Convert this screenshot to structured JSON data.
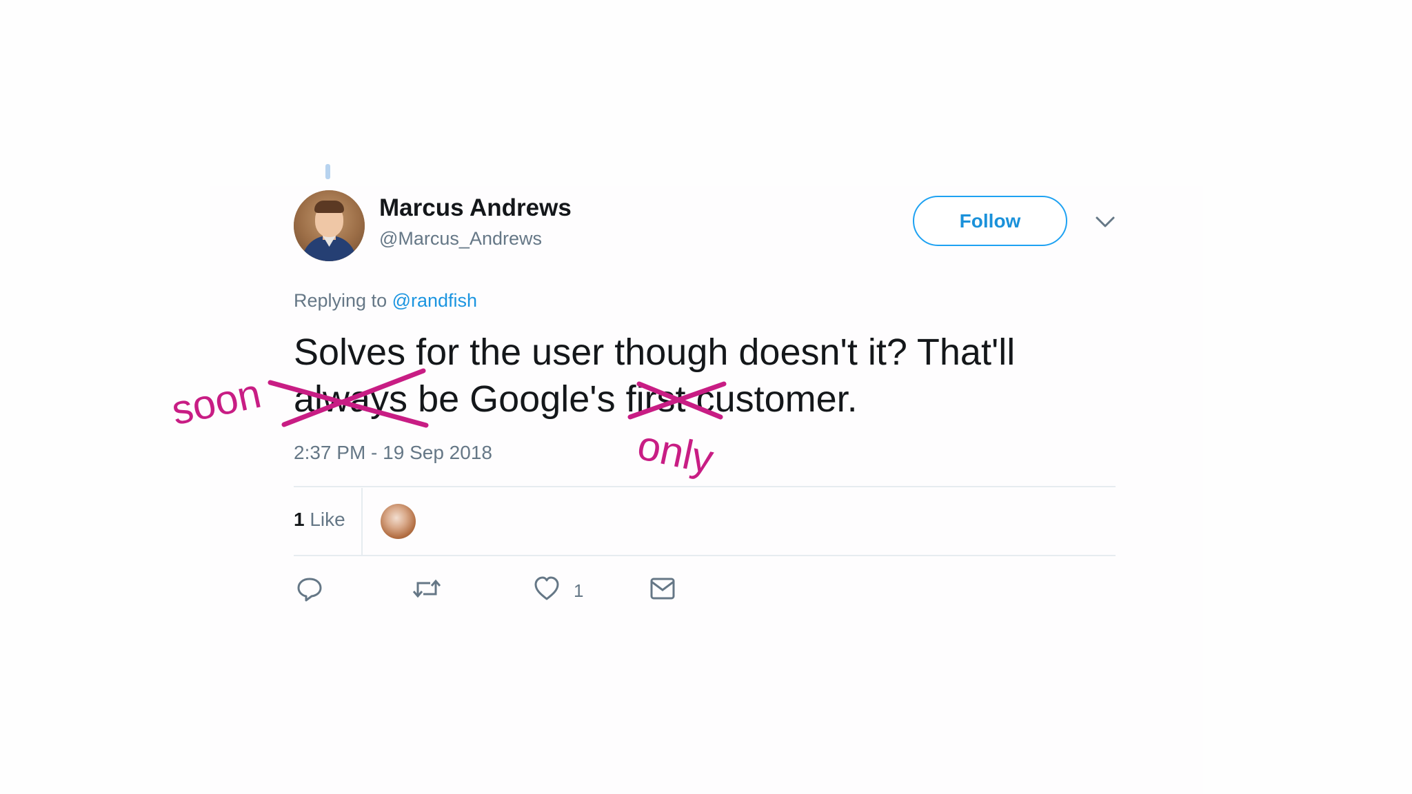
{
  "tweet": {
    "author_name": "Marcus Andrews",
    "author_handle": "@Marcus_Andrews",
    "follow_label": "Follow",
    "replying_prefix": "Replying to",
    "replying_mention": "@randfish",
    "text_line1": "Solves for the user though doesn't it? That'll",
    "text_line2_a": "always",
    "text_line2_b": " be Google's ",
    "text_line2_c": "first",
    "text_line2_d": " customer.",
    "timestamp": "2:37 PM - 19 Sep 2018",
    "like_count_bold": "1",
    "like_label": "Like",
    "action_like_count": "1"
  },
  "annotations": {
    "replacement_1": "soon",
    "replacement_2": "only",
    "color": "#c81d84"
  },
  "colors": {
    "accent": "#1da1f2",
    "text": "#14171a",
    "muted": "#657786"
  },
  "icons": [
    "reply-icon",
    "retweet-icon",
    "heart-icon",
    "message-icon",
    "chevron-down-icon"
  ]
}
